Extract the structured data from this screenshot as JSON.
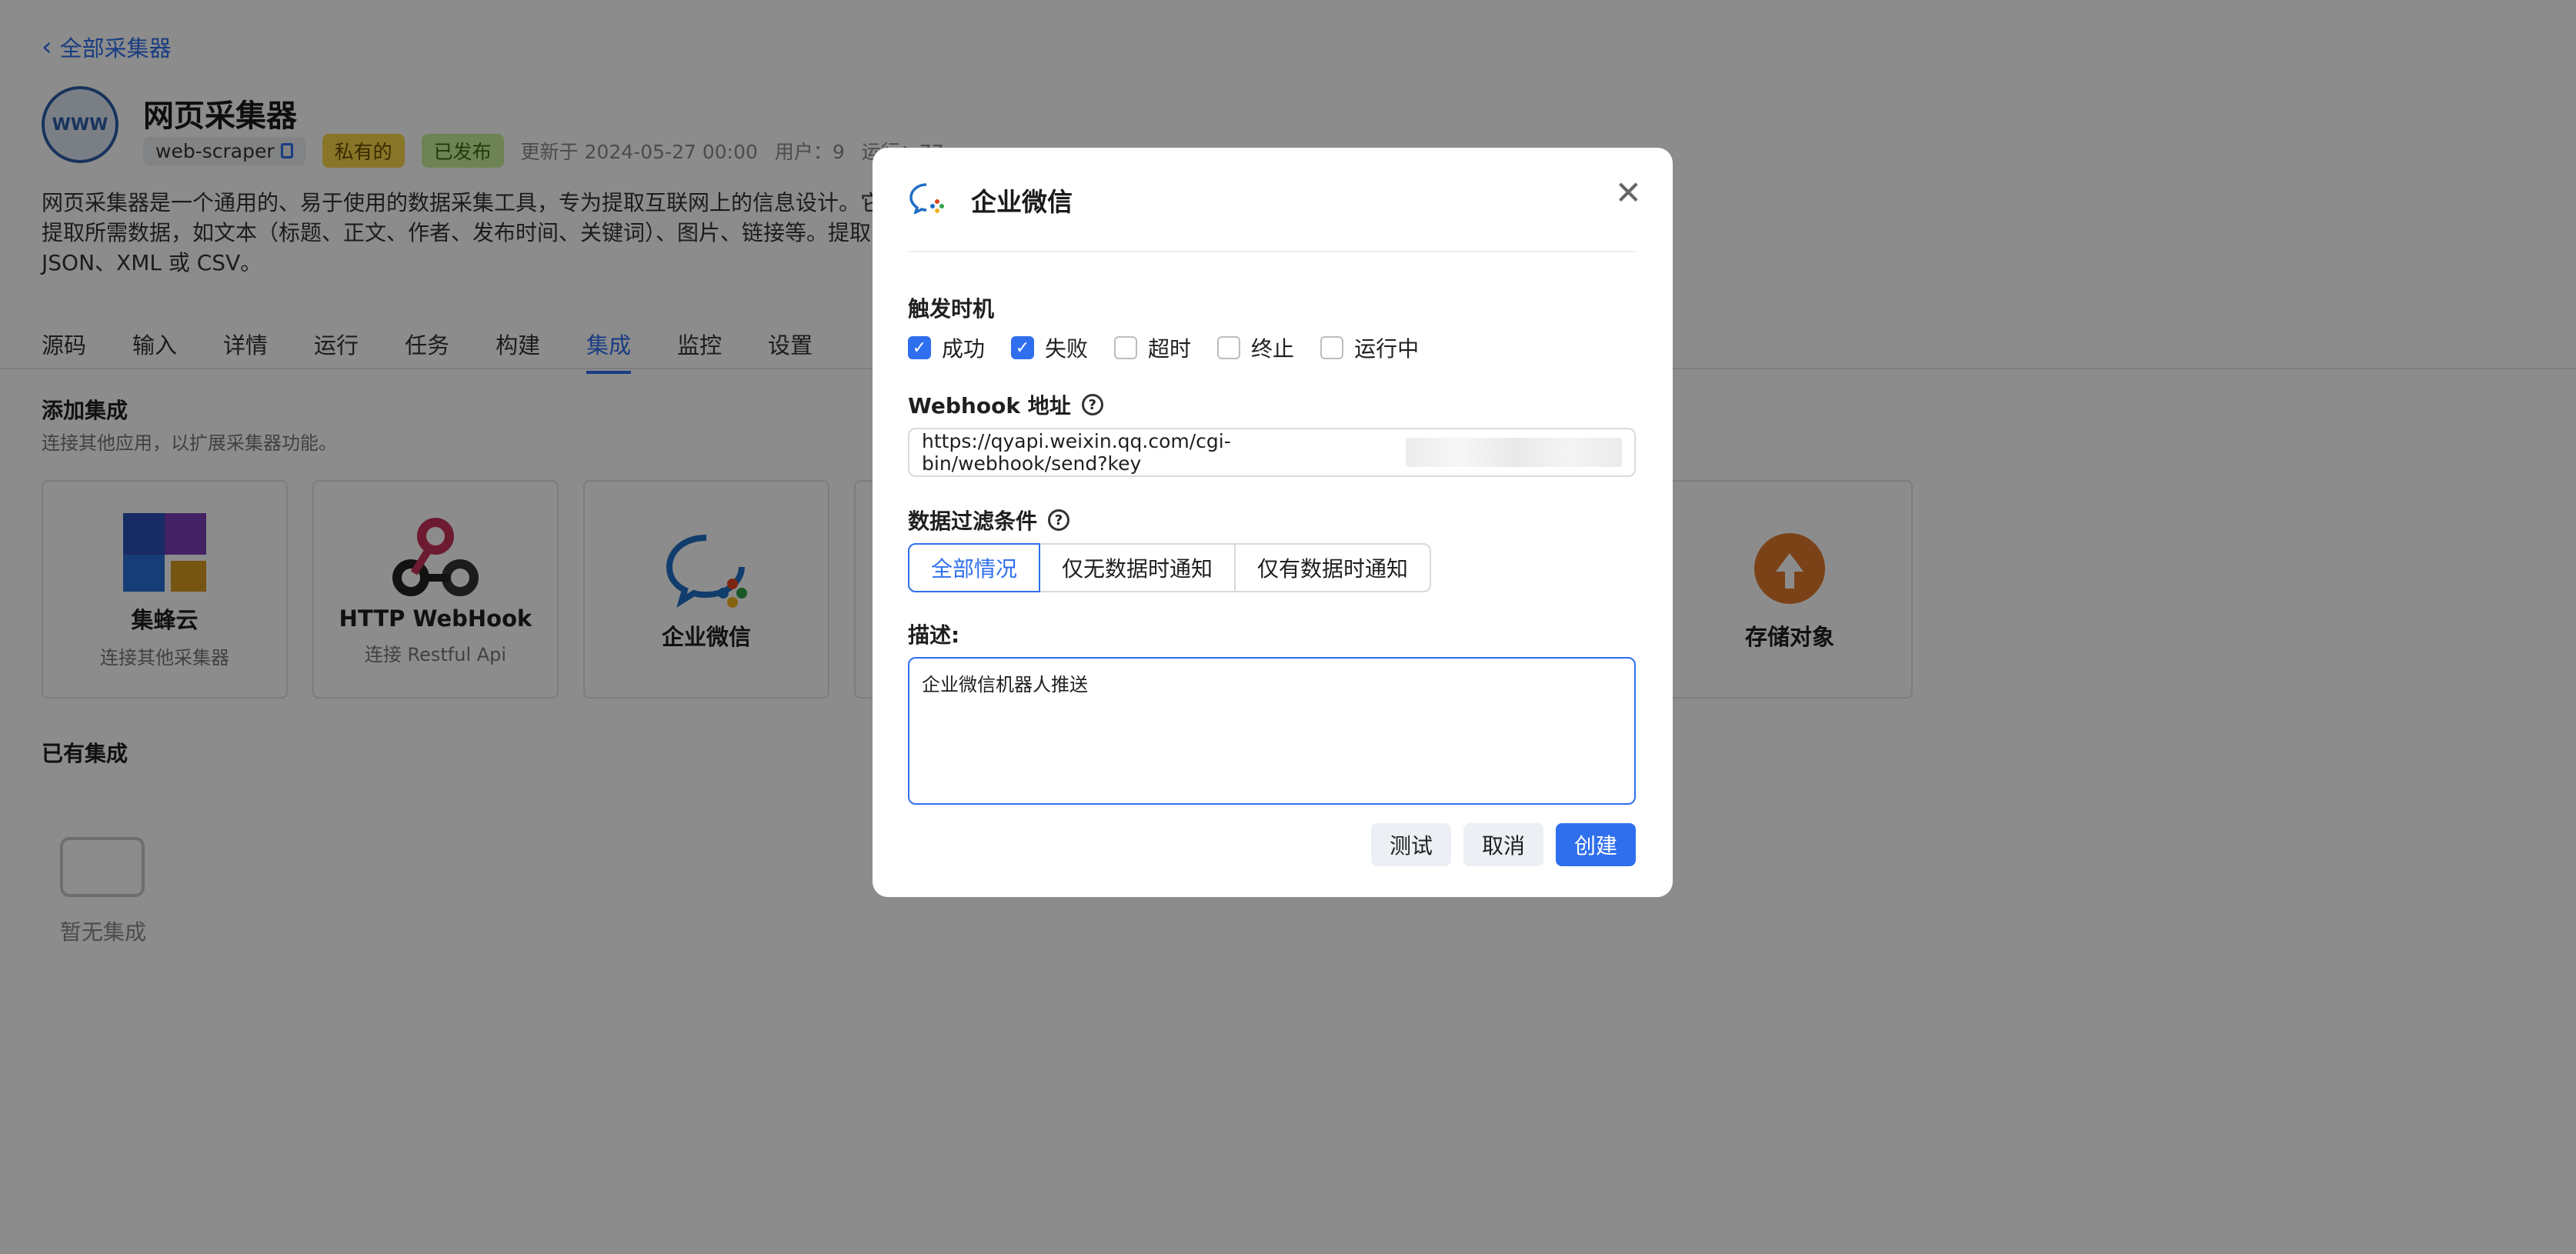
{
  "header": {
    "back_label": "全部采集器",
    "app_logo_text": "WWW",
    "title": "网页采集器",
    "slug": "web-scraper",
    "tag_private": "私有的",
    "tag_published": "已发布",
    "updated": "更新于 2024-05-27 00:00",
    "users": "用户：9",
    "runs": "运行：77",
    "description_lines": [
      "网页采集器是一个通用的、易于使用的数据采集工具，专为提取互联网上的信息设计。它",
      "提取所需数据，如文本（标题、正文、作者、发布时间、关键词）、图片、链接等。提取",
      "JSON、XML 或 CSV。"
    ]
  },
  "tabs": [
    {
      "label": "源码",
      "active": false
    },
    {
      "label": "输入",
      "active": false
    },
    {
      "label": "详情",
      "active": false
    },
    {
      "label": "运行",
      "active": false
    },
    {
      "label": "任务",
      "active": false
    },
    {
      "label": "构建",
      "active": false
    },
    {
      "label": "集成",
      "active": true
    },
    {
      "label": "监控",
      "active": false
    },
    {
      "label": "设置",
      "active": false
    }
  ],
  "add_integration": {
    "title": "添加集成",
    "subtitle": "连接其他应用，以扩展采集器功能。",
    "cards": [
      {
        "name": "集蜂云",
        "sub": "连接其他采集器",
        "icon": "jifengyun-logo-icon"
      },
      {
        "name": "HTTP WebHook",
        "sub": "连接 Restful Api",
        "icon": "webhook-icon"
      },
      {
        "name": "企业微信",
        "sub": "",
        "icon": "wecom-icon"
      },
      {
        "name": "存储对象",
        "sub": "",
        "icon": "cloud-upload-icon"
      }
    ]
  },
  "existing": {
    "title": "已有集成",
    "empty_text": "暂无集成"
  },
  "modal": {
    "title": "企业微信",
    "trigger_label": "触发时机",
    "triggers": [
      {
        "label": "成功",
        "checked": true
      },
      {
        "label": "失败",
        "checked": true
      },
      {
        "label": "超时",
        "checked": false
      },
      {
        "label": "终止",
        "checked": false
      },
      {
        "label": "运行中",
        "checked": false
      }
    ],
    "webhook_label": "Webhook 地址",
    "webhook_value": "https://qyapi.weixin.qq.com/cgi-bin/webhook/send?key",
    "filter_label": "数据过滤条件",
    "filter_options": [
      "全部情况",
      "仅无数据时通知",
      "仅有数据时通知"
    ],
    "filter_selected": "全部情况",
    "desc_label": "描述:",
    "desc_value": "企业微信机器人推送",
    "btn_test": "测试",
    "btn_cancel": "取消",
    "btn_create": "创建"
  },
  "colors": {
    "accent": "#2f6fed",
    "private_tag": "#f7d64a",
    "published_tag": "#c9ef9a"
  }
}
